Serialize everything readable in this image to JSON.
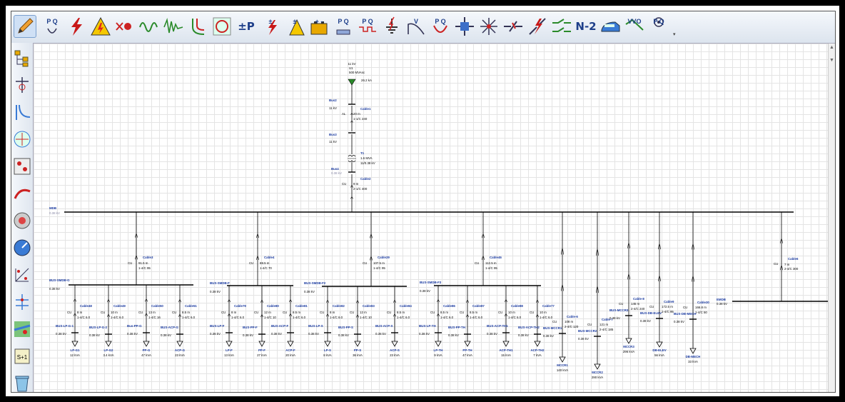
{
  "toolbar": {
    "items": [
      {
        "name": "edit-mode",
        "icon": "pencil-icon",
        "active": true
      },
      {
        "name": "load-flow",
        "icon": "load-flow-pq-icon",
        "label": "P Q"
      },
      {
        "name": "short-circuit",
        "icon": "short-circuit-icon"
      },
      {
        "name": "arc-flash",
        "icon": "arc-flash-icon"
      },
      {
        "name": "motor-starting",
        "icon": "motor-acceleration-icon"
      },
      {
        "name": "harmonic",
        "icon": "harmonic-icon"
      },
      {
        "name": "transient-stability",
        "icon": "transient-stability-icon"
      },
      {
        "name": "protective-device-coordination",
        "icon": "star-protection-icon"
      },
      {
        "name": "cable-derating",
        "icon": "cable-ampacity-icon"
      },
      {
        "name": "dc-load-flow",
        "icon": "dc-load-flow-icon",
        "label": "±P"
      },
      {
        "name": "dc-short-circuit",
        "icon": "dc-short-circuit-icon",
        "label": "±"
      },
      {
        "name": "dc-arc-flash",
        "icon": "dc-arc-flash-icon",
        "label": "±"
      },
      {
        "name": "battery-sizing",
        "icon": "battery-icon",
        "label": "+ -"
      },
      {
        "name": "unbalanced-load-flow",
        "icon": "unbalanced-load-flow-icon",
        "label": "P Q"
      },
      {
        "name": "optimal-power-flow",
        "icon": "optimal-power-flow-icon",
        "label": "P Q"
      },
      {
        "name": "grounding-grid",
        "icon": "grounding-icon"
      },
      {
        "name": "voltage-stability",
        "icon": "voltage-stability-icon",
        "label": "V"
      },
      {
        "name": "reliability",
        "icon": "reliability-icon",
        "label": "P Q"
      },
      {
        "name": "switching-sequence",
        "icon": "switching-icon"
      },
      {
        "name": "relay-test",
        "icon": "relay-test-icon"
      },
      {
        "name": "contingency",
        "icon": "contingency-icon"
      },
      {
        "name": "fault-simulation",
        "icon": "fault-icon"
      },
      {
        "name": "switch-sequence",
        "icon": "switch-sequence-icon"
      },
      {
        "name": "n-minus-2",
        "icon": "n-2-icon",
        "label": "N-2"
      },
      {
        "name": "railway",
        "icon": "train-icon"
      },
      {
        "name": "volt-var-optimization",
        "icon": "vvo-icon",
        "label": "VVO"
      },
      {
        "name": "optimal-capacitor",
        "icon": "pq-gauge-icon",
        "label": "P Q"
      }
    ],
    "overflow": "toolbar-overflow-icon"
  },
  "sidebar": {
    "items": [
      {
        "name": "project-tree",
        "icon": "tree-icon"
      },
      {
        "name": "one-line-view",
        "icon": "one-line-icon"
      },
      {
        "name": "star-view",
        "icon": "star-view-icon"
      },
      {
        "name": "ground-grid-view",
        "icon": "ground-grid-icon"
      },
      {
        "name": "control-circuit",
        "icon": "control-circuit-icon"
      },
      {
        "name": "cable-pulling",
        "icon": "cable-pulling-icon"
      },
      {
        "name": "cable-3d",
        "icon": "cable-3d-icon"
      },
      {
        "name": "dashboard",
        "icon": "gauge-icon"
      },
      {
        "name": "panel-schedule",
        "icon": "panel-icon"
      },
      {
        "name": "distribution-view",
        "icon": "distribution-icon"
      },
      {
        "name": "gis-map",
        "icon": "map-icon"
      },
      {
        "name": "sequence-editor",
        "icon": "sequence-icon",
        "label": "S+1"
      },
      {
        "name": "recycle-bin",
        "icon": "recycle-bin-icon"
      }
    ]
  },
  "colors": {
    "label_blue": "#1a3aa0",
    "grey_label": "#8a8aa8",
    "line": "#000000",
    "grid": "#e4e4e4"
  },
  "diagram": {
    "utility": {
      "voltage": "11 kV",
      "name": "U1",
      "rating": "500 MVAsc",
      "current": "26.2 kA"
    },
    "bus2": {
      "name": "Bus2",
      "voltage": "11 kV"
    },
    "cable1": {
      "name": "Cable1",
      "material": "AL",
      "length": "20 m",
      "size": "1-1/C 240"
    },
    "bus3": {
      "name": "Bus3",
      "voltage": "11 kV"
    },
    "t1": {
      "name": "T1",
      "rating": "1.6 MVA",
      "ratio": "11/0.38 kV"
    },
    "bus4": {
      "name": "Bus4",
      "voltage": "0.38 kV"
    },
    "cable2": {
      "name": "Cable2",
      "material": "CU",
      "length": "9 m",
      "size": "2-1/C 400"
    },
    "mdb": {
      "name": "MDB",
      "voltage": "0.38 kV"
    },
    "emdb": {
      "name": "EMDB",
      "voltage": "0.38 kV"
    },
    "cable6": {
      "name": "Cable6",
      "material": "CU",
      "length": "7 m",
      "size": "2-4/C 300"
    },
    "feeders": [
      {
        "cable": "Cable3",
        "length": "91.5 m",
        "size": "1-4/C 95",
        "bus": "BUS-SMDB-G",
        "busv": "0.38 kV",
        "loads": [
          {
            "cable": "Cable48",
            "length": "8 m",
            "size": "1-4/C 6.0",
            "bus": "BUS-LP-G-1",
            "busv": "0.38 kV",
            "load": "LP-G1",
            "kva": "12 kVA"
          },
          {
            "cable": "Cable49",
            "length": "10 m",
            "size": "1-4/C 6.0",
            "bus": "BUS-LP-G-2",
            "busv": "0.38 kV",
            "load": "LP-G2",
            "kva": "3.4 kVA"
          },
          {
            "cable": "Cable50",
            "length": "13 m",
            "size": "1-4/C 16",
            "bus": "Bus-PP-G",
            "busv": "0.38 kV",
            "load": "PP-G",
            "kva": "47 kVA"
          },
          {
            "cable": "Cable51",
            "length": "8.5 m",
            "size": "1-4/C 6.0",
            "bus": "BUS-ACP-G",
            "busv": "0.38 kV",
            "load": "ACP-G",
            "kva": "23 kVA"
          }
        ]
      },
      {
        "cable": "Cable4",
        "length": "88.5 m",
        "size": "1-4/C 70",
        "bus": "BUS-SMDB-F",
        "busv": "0.38 kV",
        "loads": [
          {
            "cable": "Cable79",
            "length": "8 m",
            "size": "1-4/C 6.0",
            "bus": "BUS-LP-F",
            "busv": "0.38 kV",
            "load": "LP-F",
            "kva": "13 kVA"
          },
          {
            "cable": "Cable80",
            "length": "12 m",
            "size": "1-4/C 10",
            "bus": "BUS-PP-F",
            "busv": "0.38 kV",
            "load": "PP-F",
            "kva": "27 kVA"
          },
          {
            "cable": "Cable81",
            "length": "8.5 m",
            "size": "1-4/C 6.0",
            "bus": "BUS-ACP-F",
            "busv": "0.38 kV",
            "load": "ACP-F",
            "kva": "20 kVA"
          }
        ]
      },
      {
        "cable": "Cable29",
        "length": "107.5 m",
        "size": "1-4/C 95",
        "bus": "BUS-SMDB-F2",
        "busv": "0.38 kV",
        "loads": [
          {
            "cable": "Cable82",
            "length": "8 m",
            "size": "1-4/C 6.0",
            "bus": "BUS-LP-S",
            "busv": "0.38 kV",
            "load": "LP-S",
            "kva": "8 kVA"
          },
          {
            "cable": "Cable83",
            "length": "12 m",
            "size": "1-4/C 10",
            "bus": "BUS-PP-S",
            "busv": "0.38 kV",
            "load": "PP-S",
            "kva": "36 kVA"
          },
          {
            "cable": "Cable84",
            "length": "8.5 m",
            "size": "1-4/C 6.0",
            "bus": "BUS-ACP-S",
            "busv": "0.38 kV",
            "load": "ACP-S",
            "kva": "23 kVA"
          }
        ]
      },
      {
        "cable": "Cable46",
        "length": "112.5 m",
        "size": "1-4/C 95",
        "bus": "BUS-SMDB-F3",
        "busv": "0.38 kV",
        "loads": [
          {
            "cable": "Cable86",
            "length": "8.5 m",
            "size": "1-4/C 6.0",
            "bus": "BUS-LP-TH",
            "busv": "0.38 kV",
            "load": "LP-TH",
            "kva": "9 kVA"
          },
          {
            "cable": "Cable87",
            "length": "8.5 m",
            "size": "1-4/C 6.0",
            "bus": "BUS-PP-TH",
            "busv": "0.38 kV",
            "load": "PP-TH",
            "kva": "47 kVA"
          },
          {
            "cable": "Cable88",
            "length": "10 m",
            "size": "1-4/C 6.0",
            "bus": "BUS-ACP-TH1",
            "busv": "0.38 kV",
            "load": "ACP-TH1",
            "kva": "15 kVA"
          },
          {
            "cable": "Cable77",
            "length": "10 m",
            "size": "1-4/C 6.0",
            "bus": "BUS-ACP-TH2",
            "busv": "0.38 kV",
            "load": "ACP-TH2",
            "kva": "7 kVA"
          }
        ]
      }
    ],
    "mccs": [
      {
        "cable": "Cable-6",
        "length": "108 m",
        "size": "2-4/C 120",
        "bus": "BUS-MCCR1",
        "busv": "0.38 kV",
        "load": "MCCR1",
        "kva": "140 kVA"
      },
      {
        "cable": "Cable-7",
        "length": "121 m",
        "size": "2-4/C 185",
        "bus": "BUS-MCCR2",
        "busv": "0.38 kV",
        "load": "MCCR2",
        "kva": "290 kVA"
      },
      {
        "cable": "Cable-8",
        "length": "145 m",
        "size": "2-4/C 240",
        "bus": "BUS-MCCR3",
        "busv": "0.38 kV",
        "load": "MCCR3",
        "kva": "296 kVA"
      },
      {
        "cable": "Cable9",
        "length": "172.5 m",
        "size": "1-4/C 95",
        "bus": "BUS-DB-ELEV",
        "busv": "0.38 kV",
        "load": "DB-ELEV",
        "kva": "56 kVA"
      },
      {
        "cable": "Cable30",
        "length": "166.8 m",
        "size": "1-4/C 50",
        "bus": "BUS-DB-MECH",
        "busv": "0.38 kV",
        "load": "DB-MECH",
        "kva": "33 kVA"
      }
    ],
    "conductor": "CU"
  }
}
